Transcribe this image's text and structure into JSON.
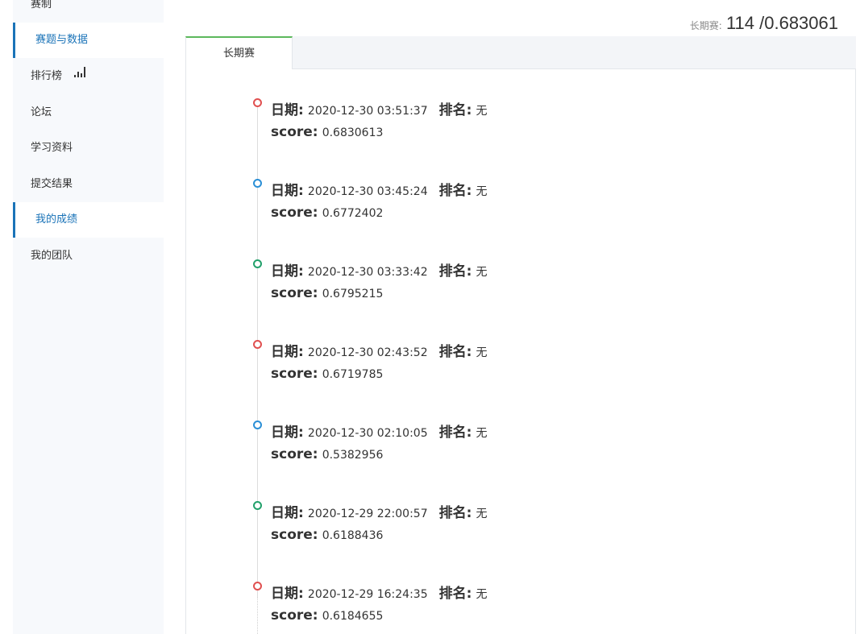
{
  "sidebar": {
    "items": [
      {
        "label": "赛制",
        "active": false
      },
      {
        "label": "赛题与数据",
        "active": true
      },
      {
        "label": "排行榜",
        "active": false,
        "icon": "bar-chart-icon"
      },
      {
        "label": "论坛",
        "active": false
      },
      {
        "label": "学习资料",
        "active": false
      },
      {
        "label": "提交结果",
        "active": false
      },
      {
        "label": "我的成绩",
        "active": true
      },
      {
        "label": "我的团队",
        "active": false
      }
    ]
  },
  "stat": {
    "label": "长期赛:",
    "value": "114 /0.683061"
  },
  "tabs": [
    {
      "label": "长期赛",
      "active": true
    }
  ],
  "timeline": {
    "date_label": "日期:",
    "rank_label": "排名:",
    "score_label": "score:",
    "entries": [
      {
        "date": "2020-12-30 03:51:37",
        "rank": "无",
        "score": "0.6830613",
        "dot_color": "#e05050"
      },
      {
        "date": "2020-12-30 03:45:24",
        "rank": "无",
        "score": "0.6772402",
        "dot_color": "#2b8fd6"
      },
      {
        "date": "2020-12-30 03:33:42",
        "rank": "无",
        "score": "0.6795215",
        "dot_color": "#22a06b"
      },
      {
        "date": "2020-12-30 02:43:52",
        "rank": "无",
        "score": "0.6719785",
        "dot_color": "#e05050"
      },
      {
        "date": "2020-12-30 02:10:05",
        "rank": "无",
        "score": "0.5382956",
        "dot_color": "#2b8fd6"
      },
      {
        "date": "2020-12-29 22:00:57",
        "rank": "无",
        "score": "0.6188436",
        "dot_color": "#22a06b"
      },
      {
        "date": "2020-12-29 16:24:35",
        "rank": "无",
        "score": "0.6184655",
        "dot_color": "#e05050"
      }
    ]
  },
  "colors": {
    "accent": "#1a73b8",
    "tab_indicator": "#5cb85c"
  }
}
